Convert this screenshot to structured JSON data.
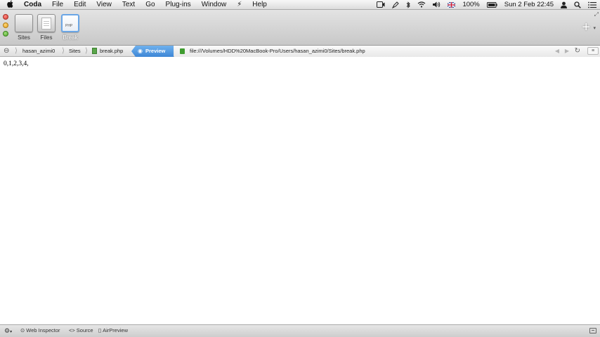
{
  "menubar": {
    "apple_icon": "apple-logo",
    "items": [
      "Coda",
      "File",
      "Edit",
      "View",
      "Text",
      "Go",
      "Plug-ins",
      "Window",
      "⚡",
      "Help"
    ],
    "status": {
      "battery_percent": "100%",
      "datetime": "Sun 2 Feb  22:45"
    }
  },
  "toolbar": {
    "buttons": [
      {
        "label": "Sites"
      },
      {
        "label": "Files"
      },
      {
        "label": "Break",
        "thumb_text": "PHP"
      }
    ],
    "add_label": "+"
  },
  "pathbar": {
    "crumbs": [
      "hasan_azimi0",
      "Sites",
      "break.php"
    ],
    "preview_label": "Preview",
    "url": "file:///Volumes/HDD%20MacBook-Pro/Users/hasan_azimi0/Sites/break.php"
  },
  "content": {
    "output": "0,1,2,3,4,"
  },
  "bottombar": {
    "items": [
      "Web Inspector",
      "Source",
      "AirPreview"
    ]
  },
  "colors": {
    "accent": "#3d86d6",
    "close": "#d8392f",
    "minimize": "#e2a21d",
    "zoom": "#4fa72b"
  }
}
